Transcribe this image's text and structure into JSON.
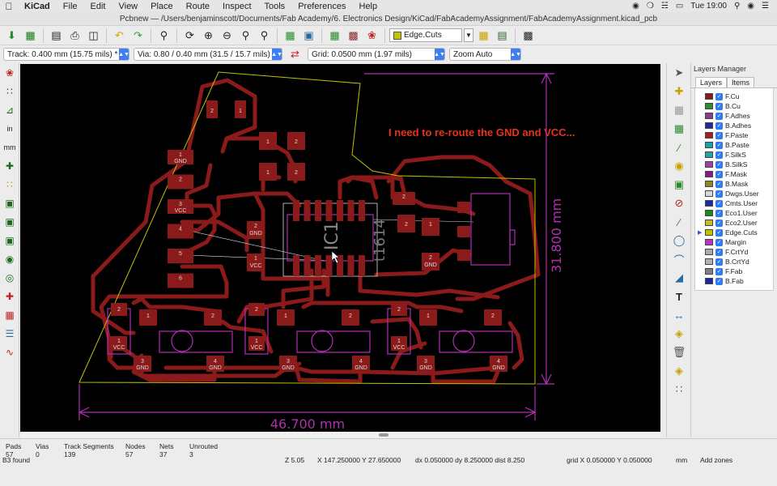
{
  "menubar": {
    "app": "KiCad",
    "items": [
      "File",
      "Edit",
      "View",
      "Place",
      "Route",
      "Inspect",
      "Tools",
      "Preferences",
      "Help"
    ],
    "time": "Tue 19:00"
  },
  "window": {
    "title": "Pcbnew — /Users/benjaminscott/Documents/Fab Academy/6. Electronics Design/KiCad/FabAcademyAssignment/FabAcademyAssignment.kicad_pcb"
  },
  "toolbar": {
    "active_layer": "Edge.Cuts"
  },
  "options": {
    "track": "Track: 0.400 mm (15.75 mils) *",
    "via": "Via: 0.80 / 0.40 mm (31.5 / 15.7 mils) *",
    "grid": "Grid: 0.0500 mm (1.97 mils)",
    "zoom": "Zoom Auto"
  },
  "board": {
    "note": "I need to re-route the GND and VCC...",
    "width_dim": "46.700 mm",
    "height_dim": "31.800 mm",
    "ic_ref": "IC1",
    "ic_value": "t1614",
    "header_labels": [
      "GND",
      "",
      "VCC",
      "",
      "",
      ""
    ],
    "header_pins": [
      "1",
      "2",
      "3",
      "4",
      "5",
      "6"
    ],
    "pad_labels": {
      "gnd": "GND",
      "vcc": "VCC"
    },
    "pins": {
      "one": "1",
      "two": "2",
      "three": "3",
      "four": "4"
    }
  },
  "layers_manager": {
    "title": "Layers Manager",
    "tabs": [
      "Layers",
      "Items"
    ],
    "active_layer": "Edge.Cuts",
    "layers": [
      {
        "name": "F.Cu",
        "color": "#8b1a1a"
      },
      {
        "name": "B.Cu",
        "color": "#2e8b2e"
      },
      {
        "name": "F.Adhes",
        "color": "#8a3c8a"
      },
      {
        "name": "B.Adhes",
        "color": "#1e2a9a"
      },
      {
        "name": "F.Paste",
        "color": "#a02020"
      },
      {
        "name": "B.Paste",
        "color": "#1aa3a3"
      },
      {
        "name": "F.SilkS",
        "color": "#2aa0a0"
      },
      {
        "name": "B.SilkS",
        "color": "#a040a0"
      },
      {
        "name": "F.Mask",
        "color": "#8a1a8a"
      },
      {
        "name": "B.Mask",
        "color": "#8a8a20"
      },
      {
        "name": "Dwgs.User",
        "color": "#d8d8d8"
      },
      {
        "name": "Cmts.User",
        "color": "#1a2aa0"
      },
      {
        "name": "Eco1.User",
        "color": "#1e8a1e"
      },
      {
        "name": "Eco2.User",
        "color": "#c0c020"
      },
      {
        "name": "Edge.Cuts",
        "color": "#c2c200"
      },
      {
        "name": "Margin",
        "color": "#c030c0"
      },
      {
        "name": "F.CrtYd",
        "color": "#aaaaaa"
      },
      {
        "name": "B.CrtYd",
        "color": "#b0b0b0"
      },
      {
        "name": "F.Fab",
        "color": "#808080"
      },
      {
        "name": "B.Fab",
        "color": "#1a2a9a"
      }
    ]
  },
  "status": {
    "pads_label": "Pads",
    "pads": "57",
    "vias_label": "Vias",
    "vias": "0",
    "tracks_label": "Track Segments",
    "tracks": "139",
    "nodes_label": "Nodes",
    "nodes": "57",
    "nets_label": "Nets",
    "nets": "37",
    "unrouted_label": "Unrouted",
    "unrouted": "3",
    "found": "B3 found",
    "zoom": "Z 5.05",
    "coords": "X 147.250000  Y 27.650000",
    "delta": "dx 0.050000  dy 8.250000  dist 8.250",
    "grid": "grid X 0.050000  Y 0.050000",
    "units": "mm",
    "mode": "Add zones"
  }
}
